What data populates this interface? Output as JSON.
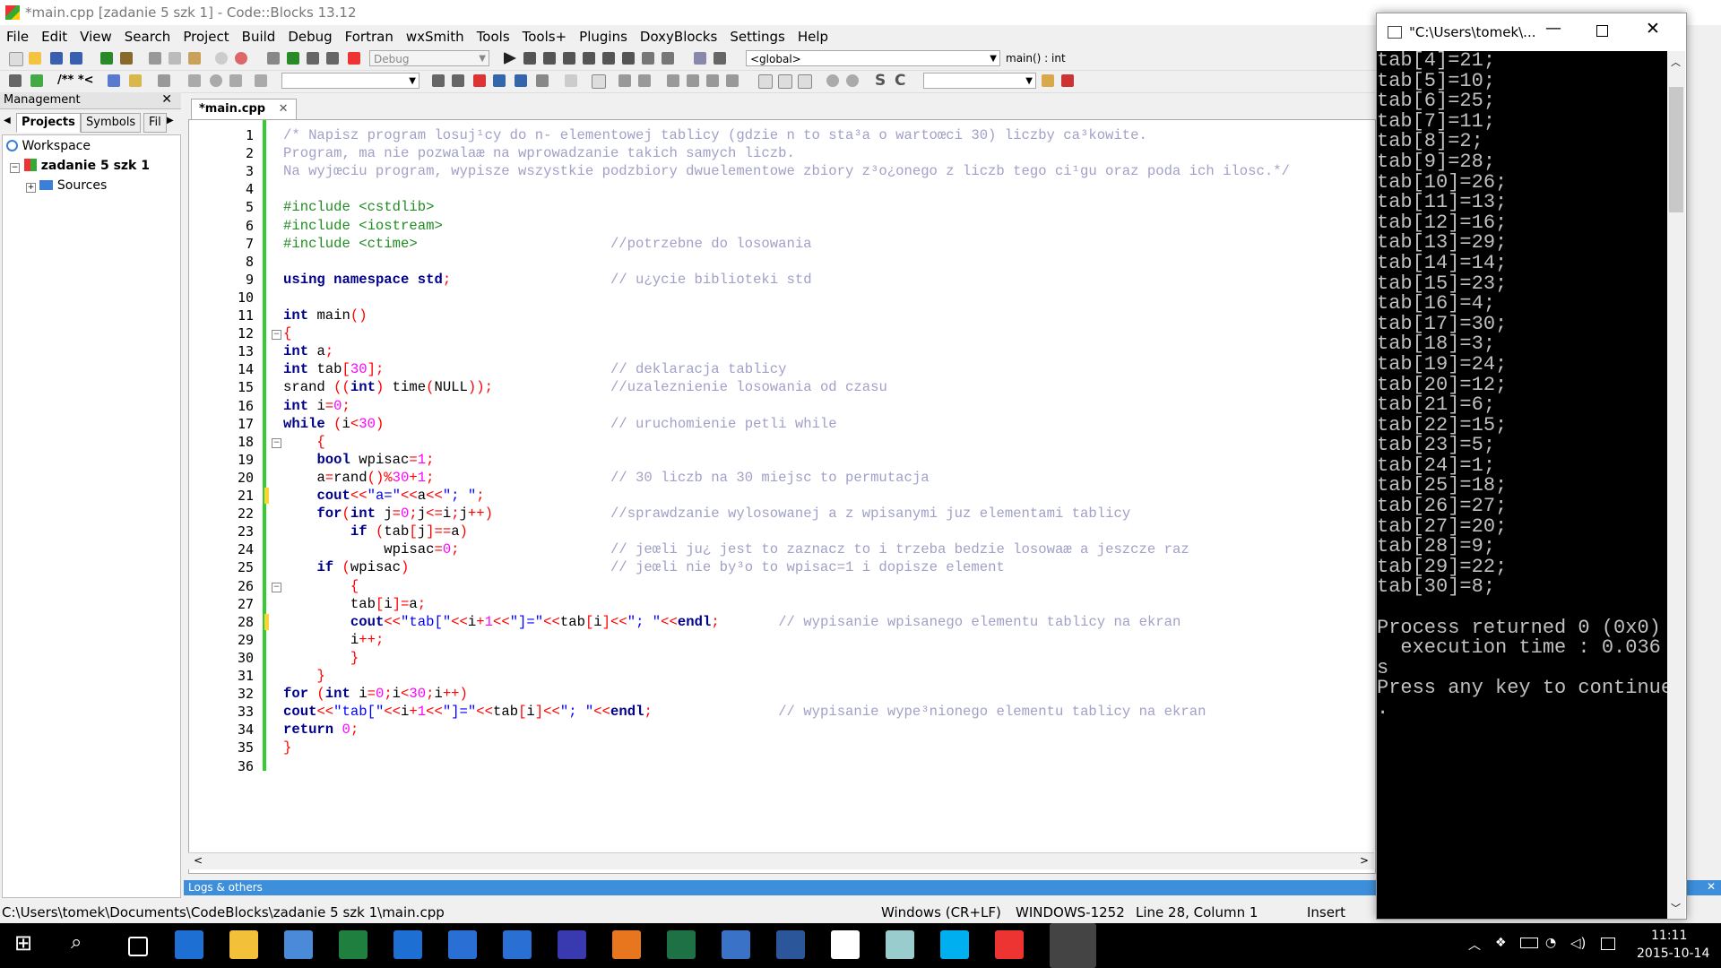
{
  "window": {
    "title": "*main.cpp [zadanie 5 szk 1] - Code::Blocks 13.12"
  },
  "menu": [
    "File",
    "Edit",
    "View",
    "Search",
    "Project",
    "Build",
    "Debug",
    "Fortran",
    "wxSmith",
    "Tools",
    "Tools+",
    "Plugins",
    "DoxyBlocks",
    "Settings",
    "Help"
  ],
  "toolbar": {
    "build_target": "Debug",
    "scope": "<global>",
    "function": "main() : int"
  },
  "management": {
    "title": "Management",
    "tabs": [
      "Projects",
      "Symbols",
      "Fil"
    ],
    "tree": {
      "workspace": "Workspace",
      "project": "zadanie 5 szk 1",
      "folder": "Sources"
    }
  },
  "editor": {
    "tab": "*main.cpp",
    "lines": [
      "/* Napisz program losuj¹cy do n- elementowej tablicy (gdzie n to sta³a o wartoœci 30) liczby ca³kowite.",
      "Program, ma nie pozwalaæ na wprowadzanie takich samych liczb.",
      "Na wyjœciu program, wypisze wszystkie podzbiory dwuelementowe zbiory z³o¿onego z liczb tego ci¹gu oraz poda ich ilosc.*/",
      "",
      "#include <cstdlib>",
      "#include <iostream>",
      "#include <ctime>                       //potrzebne do losowania",
      "",
      "using namespace std;                   // u¿ycie biblioteki std",
      "",
      "int main()",
      "{",
      "int a;",
      "int tab[30];                           // deklaracja tablicy",
      "srand ((int) time(NULL));              //uzaleznienie losowania od czasu",
      "int i=0;",
      "while (i<30)                           // uruchomienie petli while",
      "    {",
      "    bool wpisac=1;",
      "    a=rand()%30+1;                     // 30 liczb na 30 miejsc to permutacja",
      "    cout<<\"a=\"<<a<<\"; \";",
      "    for(int j=0;j<=i;j++)              //sprawdzanie wylosowanej a z wpisanymi juz elementami tablicy",
      "        if (tab[j]==a)",
      "            wpisac=0;                  // jeœli ju¿ jest to zaznacz to i trzeba bedzie losowaæ a jeszcze raz",
      "    if (wpisac)                        // jeœli nie by³o to wpisac=1 i dopisze element",
      "        {",
      "        tab[i]=a;",
      "        cout<<\"tab[\"<<i+1<<\"]=\"<<tab[i]<<\"; \"<<endl;       // wypisanie wpisanego elementu tablicy na ekran",
      "        i++;",
      "        }",
      "    }",
      "for (int i=0;i<30;i++)",
      "cout<<\"tab[\"<<i+1<<\"]=\"<<tab[i]<<\"; \"<<endl;               // wypisanie wype³nionego elementu tablicy na ekran",
      "return 0;",
      "}",
      ""
    ]
  },
  "logs": {
    "label": "Logs & others"
  },
  "status": {
    "path": "C:\\Users\\tomek\\Documents\\CodeBlocks\\zadanie 5 szk 1\\main.cpp",
    "eol": "Windows (CR+LF)",
    "encoding": "WINDOWS-1252",
    "position": "Line 28, Column 1",
    "mode": "Insert"
  },
  "console": {
    "title": "\"C:\\Users\\tomek\\...",
    "lines": [
      "tab[4]=21;",
      "tab[5]=10;",
      "tab[6]=25;",
      "tab[7]=11;",
      "tab[8]=2;",
      "tab[9]=28;",
      "tab[10]=26;",
      "tab[11]=13;",
      "tab[12]=16;",
      "tab[13]=29;",
      "tab[14]=14;",
      "tab[15]=23;",
      "tab[16]=4;",
      "tab[17]=30;",
      "tab[18]=3;",
      "tab[19]=24;",
      "tab[20]=12;",
      "tab[21]=6;",
      "tab[22]=15;",
      "tab[23]=5;",
      "tab[24]=1;",
      "tab[25]=18;",
      "tab[26]=27;",
      "tab[27]=20;",
      "tab[28]=9;",
      "tab[29]=22;",
      "tab[30]=8;",
      "",
      "Process returned 0 (0x0)",
      "  execution time : 0.036",
      "s",
      "Press any key to continue",
      "."
    ]
  },
  "taskbar": {
    "time": "11:11",
    "date": "2015-10-14",
    "apps": [
      "start-icon",
      "search-icon",
      "task-view-icon",
      "edge-icon",
      "file-explorer-icon",
      "control-panel-icon",
      "store-icon",
      "mail-icon",
      "remote-desktop-icon",
      "network-icon",
      "save-icon",
      "firefox-icon",
      "excel-icon",
      "thunderbird-icon",
      "word-icon",
      "home-icon",
      "files-icon",
      "skype-icon",
      "codeblocks-icon",
      "console-icon"
    ]
  }
}
